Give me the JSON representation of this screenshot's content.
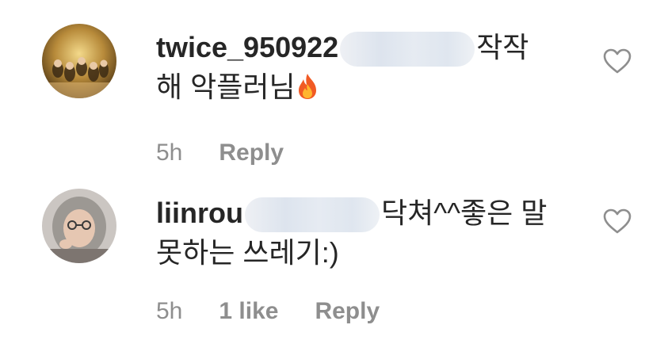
{
  "comments": [
    {
      "username": "twice_950922",
      "text_line1": "작작",
      "text_line2": "해 악플러님",
      "time": "5h",
      "likes": "",
      "reply": "Reply",
      "emoji": "fire"
    },
    {
      "username": "liinrou",
      "text_line1": "닥쳐^^좋은 말",
      "text_line2": "못하는 쓰레기:)",
      "time": "5h",
      "likes": "1 like",
      "reply": "Reply",
      "emoji": ""
    }
  ],
  "colors": {
    "text": "#262626",
    "meta": "#8e8e8e",
    "heart_outline": "#8e8e8e"
  }
}
